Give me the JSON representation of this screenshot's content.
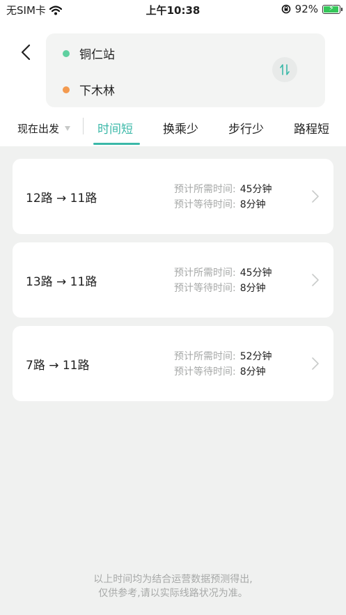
{
  "status_bar": {
    "carrier": "无SIM卡",
    "time": "上午10:38",
    "battery": "92%"
  },
  "route": {
    "origin": "铜仁站",
    "destination": "下木林",
    "origin_color": "#5fd0a0",
    "destination_color": "#f39a4f"
  },
  "filters": {
    "depart": "现在出发",
    "tabs": [
      "时间短",
      "换乘少",
      "步行少",
      "路程短"
    ],
    "active_tab": "时间短",
    "accent": "#3ab8a8"
  },
  "routes": [
    {
      "lines": "12路 → 11路",
      "duration_label": "预计所需时间:",
      "duration": "45分钟",
      "wait_label": "预计等待时间:",
      "wait": "8分钟"
    },
    {
      "lines": "13路 → 11路",
      "duration_label": "预计所需时间:",
      "duration": "45分钟",
      "wait_label": "预计等待时间:",
      "wait": "8分钟"
    },
    {
      "lines": "7路 → 11路",
      "duration_label": "预计所需时间:",
      "duration": "52分钟",
      "wait_label": "预计等待时间:",
      "wait": "8分钟"
    }
  ],
  "footer": {
    "line1": "以上时间均为结合运营数据预测得出,",
    "line2": "仅供参考,请以实际线路状况为准。"
  }
}
